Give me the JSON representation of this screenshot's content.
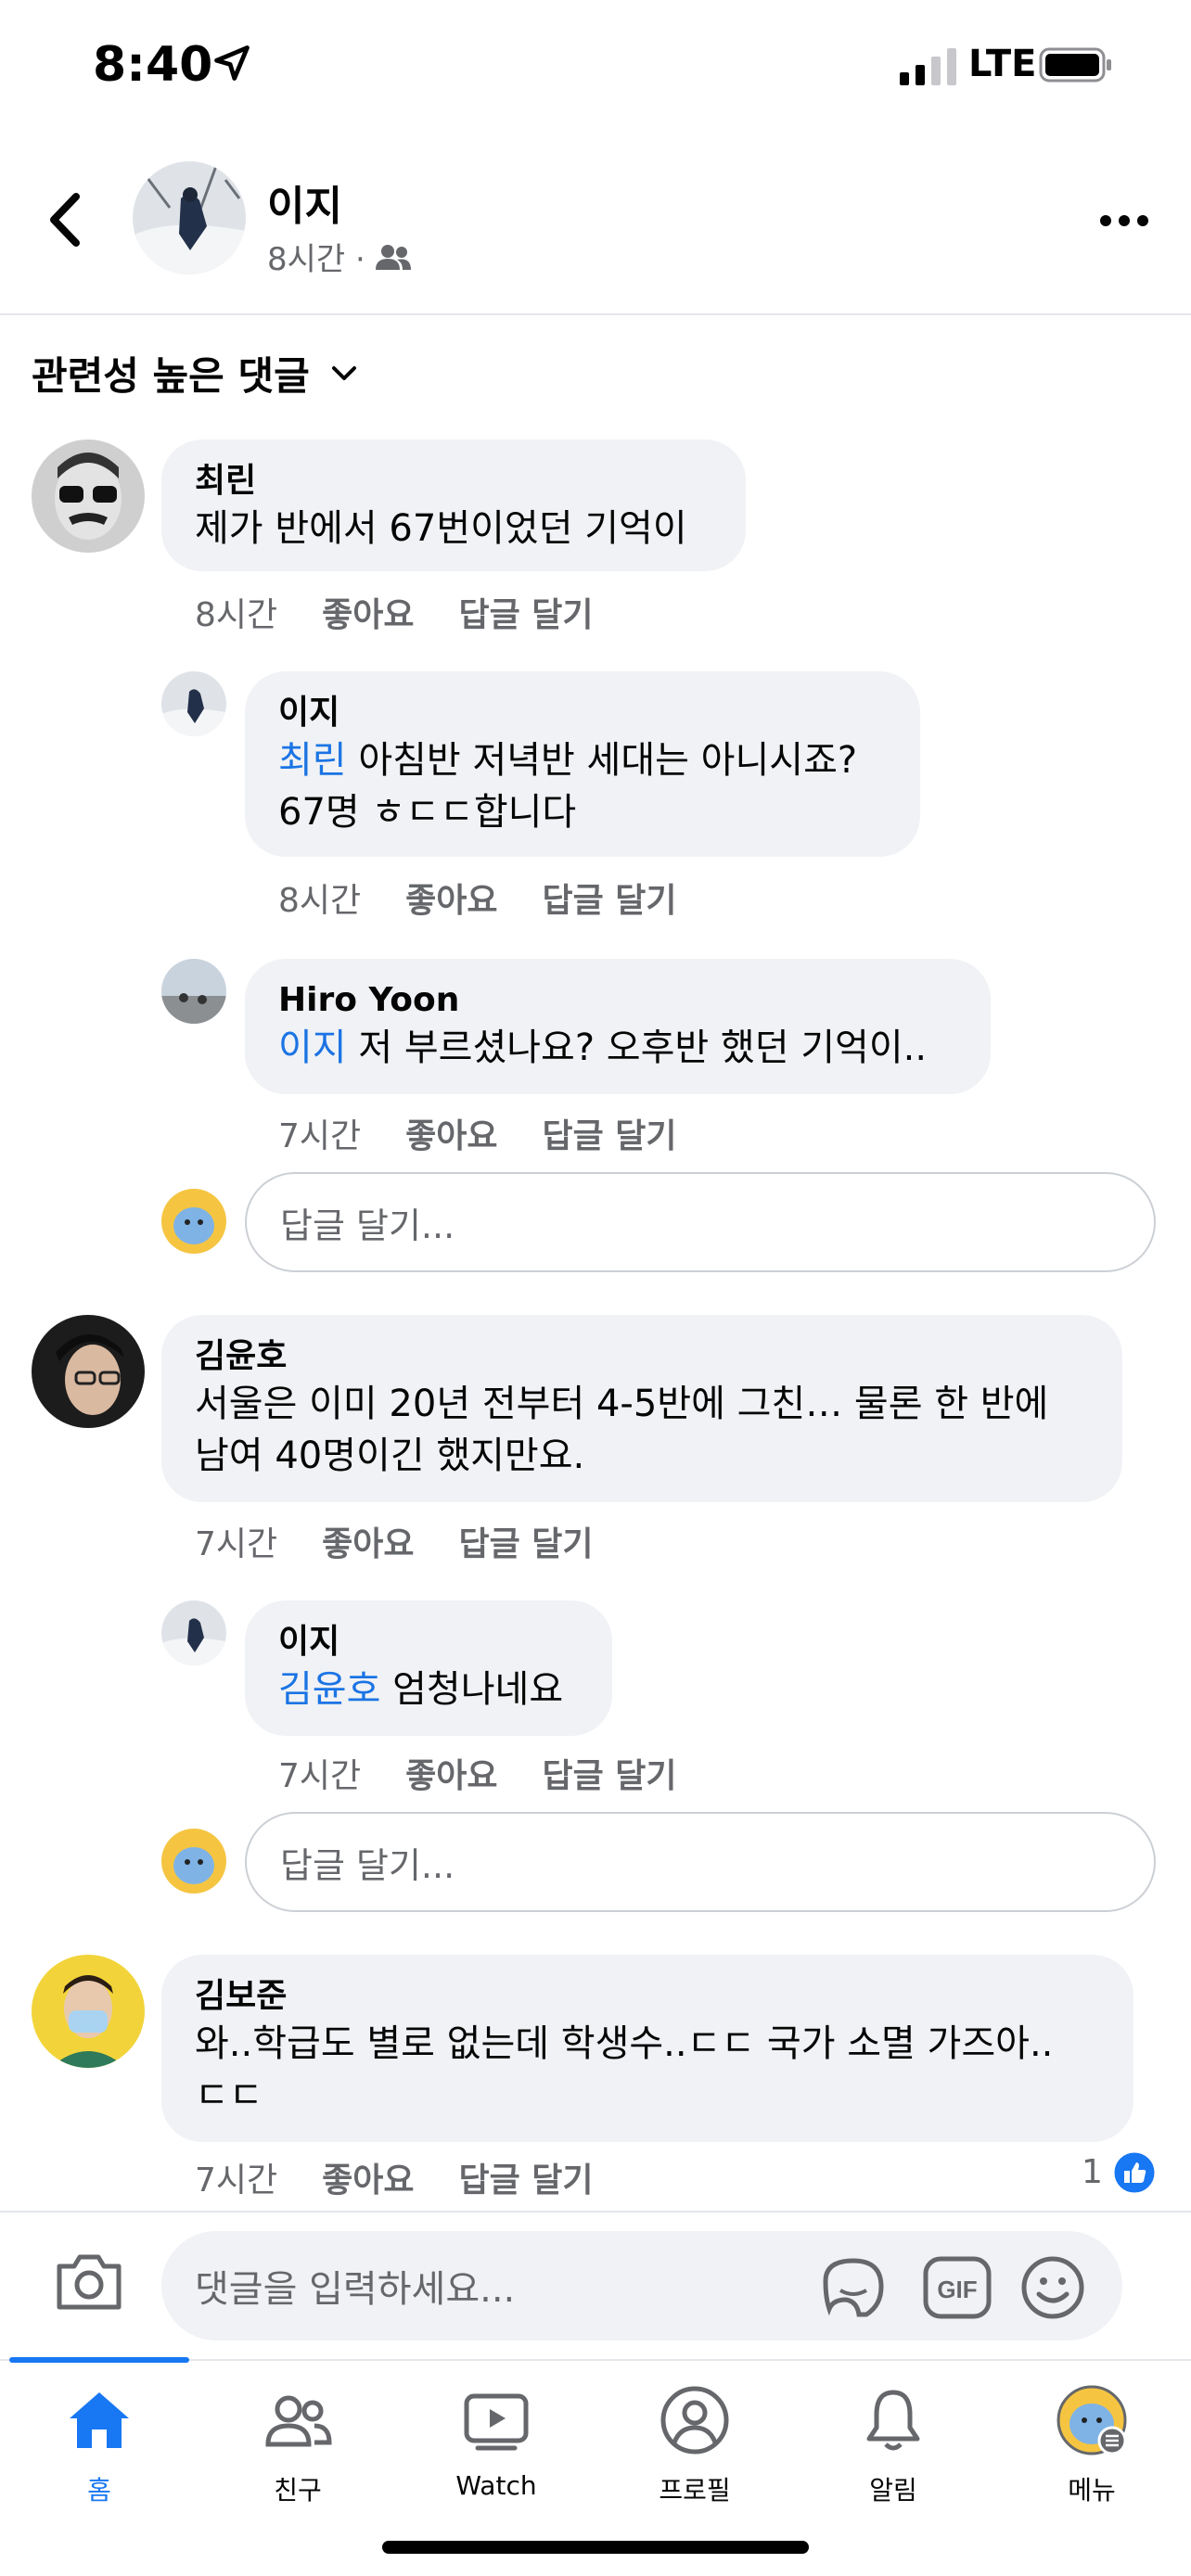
{
  "status_bar": {
    "time": "8:40",
    "network": "LTE"
  },
  "header": {
    "name": "이지",
    "meta": "8시간 ·"
  },
  "sort": {
    "label": "관련성 높은 댓글"
  },
  "comments": [
    {
      "name": "최린",
      "text": "제가 반에서 67번이었던 기억이",
      "time": "8시간",
      "like": "좋아요",
      "reply": "답글 달기"
    },
    {
      "name": "이지",
      "mention": "최린",
      "text": "아침반 저녁반 세대는 아니시죠?",
      "text2": "67명 ㅎㄷㄷ합니다",
      "time": "8시간",
      "like": "좋아요",
      "reply": "답글 달기"
    },
    {
      "name": "Hiro Yoon",
      "mention": "이지",
      "text": "저 부르셨나요? 오후반 했던 기억이..",
      "time": "7시간",
      "like": "좋아요",
      "reply": "답글 달기"
    },
    {
      "name": "김윤호",
      "text": "서울은 이미 20년 전부터 4-5반에 그친… 물론 한 반에",
      "text2": "남여 40명이긴 했지만요.",
      "time": "7시간",
      "like": "좋아요",
      "reply": "답글 달기"
    },
    {
      "name": "이지",
      "mention": "김윤호",
      "text": "엄청나네요",
      "time": "7시간",
      "like": "좋아요",
      "reply": "답글 달기"
    },
    {
      "name": "김보준",
      "text": "와..학급도 별로 없는데 학생수..ㄷㄷ 국가 소멸  가즈아..",
      "text2": "ㄷㄷ",
      "time": "7시간",
      "like": "좋아요",
      "reply": "답글 달기",
      "reactions": "1"
    }
  ],
  "reply_input_placeholder": "답글 달기...",
  "compose": {
    "placeholder": "댓글을 입력하세요..."
  },
  "tabs": [
    {
      "label": "홈",
      "icon": "home-icon",
      "active": true
    },
    {
      "label": "친구",
      "icon": "friends-icon"
    },
    {
      "label": "Watch",
      "icon": "watch-icon"
    },
    {
      "label": "프로필",
      "icon": "profile-icon"
    },
    {
      "label": "알림",
      "icon": "bell-icon"
    },
    {
      "label": "메뉴",
      "icon": "menu-avatar-icon"
    }
  ],
  "colors": {
    "accent": "#1877f2",
    "mention": "#1b74e4",
    "bubble": "#f0f2f5",
    "meta": "#65676b"
  }
}
